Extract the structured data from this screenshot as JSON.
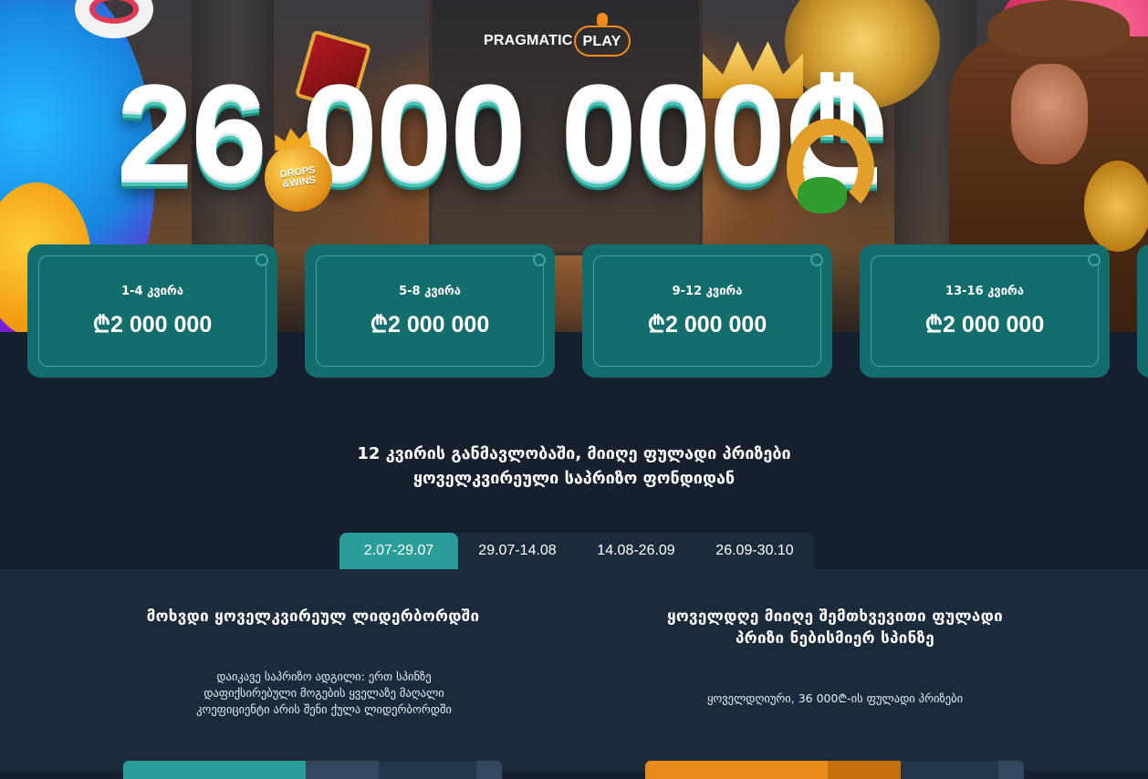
{
  "hero": {
    "brand_name": "PRAGMATIC",
    "brand_badge": "PLAY",
    "prize_amount": "26 000 000₾",
    "badge_line1": "DROPS",
    "badge_line2": "&WINS"
  },
  "weeks": [
    {
      "label": "1-4 კვირა",
      "amount": "₾2 000 000"
    },
    {
      "label": "5-8 კვირა",
      "amount": "₾2 000 000"
    },
    {
      "label": "9-12 კვირა",
      "amount": "₾2 000 000"
    },
    {
      "label": "13-16 კვირა",
      "amount": "₾2 000 000"
    }
  ],
  "intro": {
    "line1": "12 კვირის განმავლობაში, მიიღე ფულადი პრიზები",
    "line2": "ყოველკვირეული საპრიზო ფონდიდან"
  },
  "tabs": [
    {
      "label": "2.07-29.07",
      "active": true
    },
    {
      "label": "29.07-14.08",
      "active": false
    },
    {
      "label": "14.08-26.09",
      "active": false
    },
    {
      "label": "26.09-30.10",
      "active": false
    }
  ],
  "leaderboard": {
    "title": "მოხვდი ყოველკვირეულ ლიდერბორდში",
    "desc_line1": "დაიკავე საპრიზო ადგილი: ერთ სპინზე",
    "desc_line2": "დაფიქსირებული მოგების ყველაზე მაღალი",
    "desc_line3": "კოეფიციენტი არის შენი ქულა ლიდერბორდში"
  },
  "daily": {
    "title_line1": "ყოველდღე მიიღე შემთხვევითი ფულადი",
    "title_line2": "პრიზი ნებისმიერ სპინზე",
    "desc": "ყოველდღიური, 36 000₾-ის ფულადი პრიზები"
  },
  "colors": {
    "page_bg": "#16202f",
    "panel_bg": "#1c2b3c",
    "card_bg": "#146d6d",
    "tab_active": "#2a9d9b",
    "bar_teal": "#2a9d9b",
    "bar_orange": "#e88a1a"
  }
}
